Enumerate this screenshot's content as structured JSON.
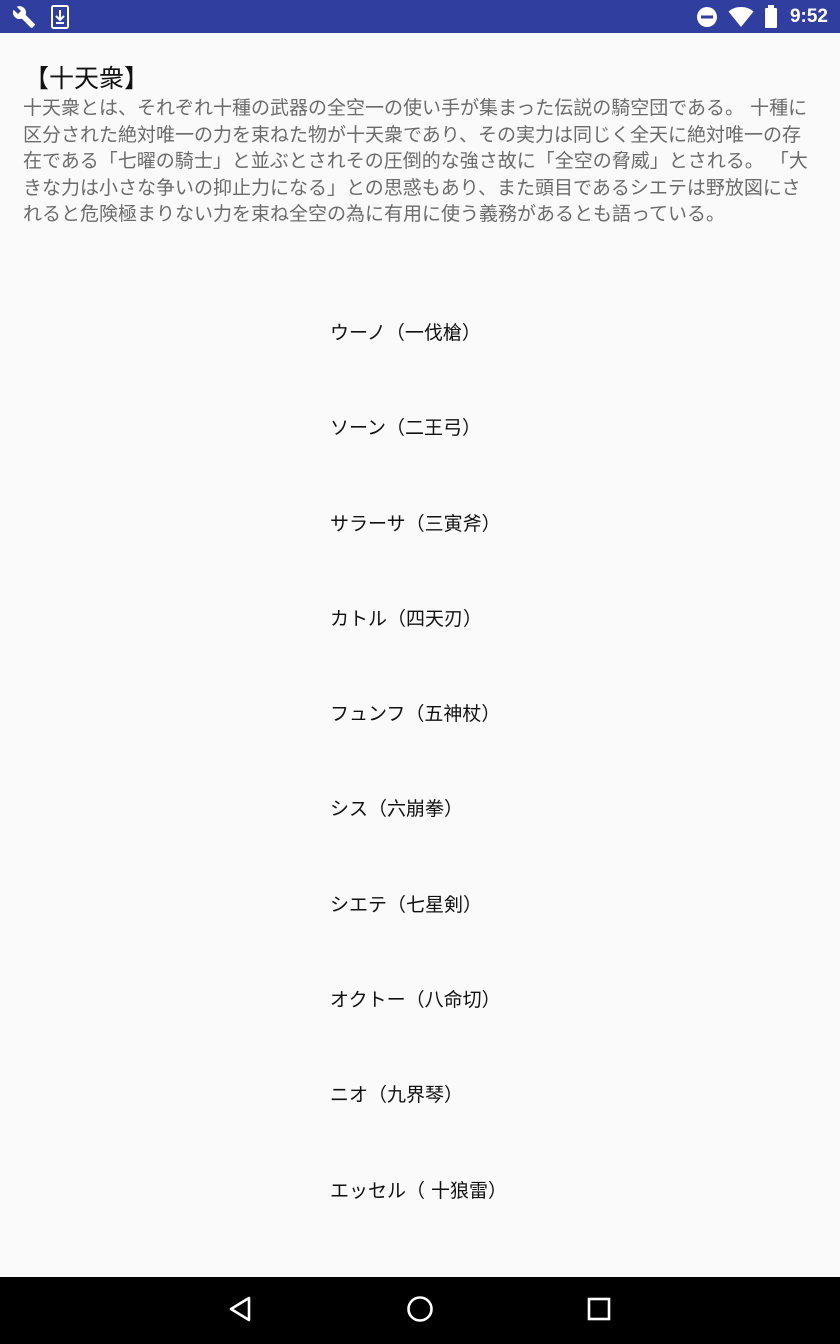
{
  "status_bar": {
    "time": "9:52",
    "icons": [
      "wrench-icon",
      "download-icon",
      "do-not-disturb-icon",
      "wifi-icon",
      "battery-icon"
    ],
    "background_color": "#303f9f"
  },
  "content": {
    "title": "【十天衆】",
    "description": "十天衆とは、それぞれ十種の武器の全空一の使い手が集まった伝説の騎空団である。 十種に区分された絶対唯一の力を束ねた物が十天衆であり、その実力は同じく全天に絶対唯一の存在である「七曜の騎士」と並ぶとされその圧倒的な強さ故に「全空の脅威」とされる。 「大きな力は小さな争いの抑止力になる」との思惑もあり、また頭目であるシエテは野放図にされると危険極まりない力を束ね全空の為に有用に使う義務があるとも語っている。",
    "members": [
      "ウーノ（一伐槍）",
      "ソーン（二王弓）",
      "サラーサ（三寅斧）",
      "カトル（四天刃）",
      "フュンフ（五神杖）",
      "シス（六崩拳）",
      "シエテ（七星剣）",
      "オクトー（八命切）",
      "ニオ（九界琴）",
      "エッセル（ 十狼雷）"
    ]
  },
  "nav_bar": {
    "icons": [
      "back-icon",
      "home-icon",
      "recents-icon"
    ]
  }
}
